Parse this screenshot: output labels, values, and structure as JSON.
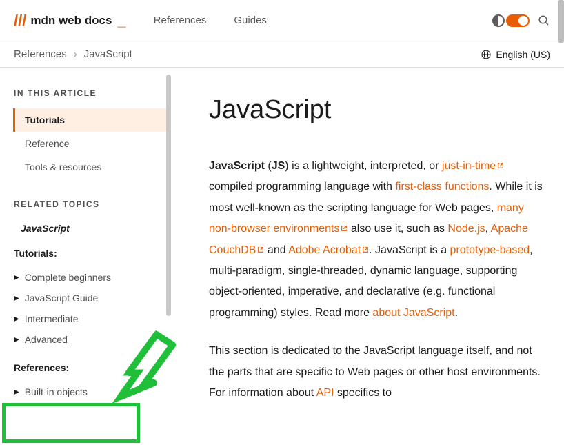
{
  "header": {
    "logo_text": "mdn web docs",
    "nav": [
      "References",
      "Guides"
    ]
  },
  "breadcrumb": {
    "items": [
      "References",
      "JavaScript"
    ],
    "language": "English (US)"
  },
  "sidebar": {
    "toc_title": "IN THIS ARTICLE",
    "toc": [
      {
        "label": "Tutorials",
        "active": true
      },
      {
        "label": "Reference",
        "active": false
      },
      {
        "label": "Tools & resources",
        "active": false
      }
    ],
    "related_title": "RELATED TOPICS",
    "related_current": "JavaScript",
    "tutorials_title": "Tutorials:",
    "tutorials": [
      "Complete beginners",
      "JavaScript Guide",
      "Intermediate",
      "Advanced"
    ],
    "references_title": "References:",
    "references": [
      "Built-in objects"
    ]
  },
  "article": {
    "title": "JavaScript",
    "p1": {
      "t0": "JavaScript",
      "t1": " (",
      "t2": "JS",
      "t3": ") is a lightweight, interpreted, or ",
      "l1": "just-in-time",
      "t4": " compiled programming language with ",
      "l2": "first-class functions",
      "t5": ". While it is most well-known as the scripting language for Web pages, ",
      "l3": "many non-browser environments",
      "t6": " also use it, such as ",
      "l4": "Node.js",
      "t7": ", ",
      "l5": "Apache CouchDB",
      "t8": " and ",
      "l6": "Adobe Acrobat",
      "t9": ". JavaScript is a ",
      "l7": "prototype-based",
      "t10": ", multi-paradigm, single-threaded, dynamic language, supporting object-oriented, imperative, and declarative (e.g. functional programming) styles. Read more ",
      "l8": "about JavaScript",
      "t11": "."
    },
    "p2": {
      "t0": "This section is dedicated to the JavaScript language itself, and not the parts that are specific to Web pages or other host environments. For information about ",
      "l1": "API",
      "t1": " specifics to"
    }
  }
}
